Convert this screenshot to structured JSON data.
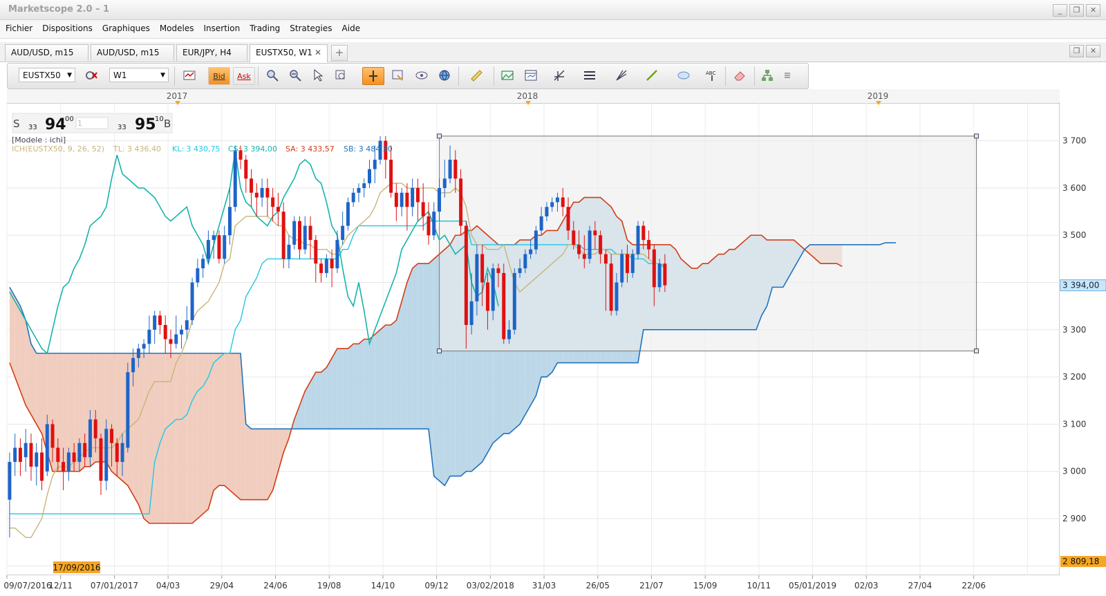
{
  "window": {
    "title": "Marketscope 2.0 – 1",
    "controls": [
      "_",
      "❐",
      "✕"
    ]
  },
  "menu": [
    "Fichier",
    "Dispositions",
    "Graphiques",
    "Modeles",
    "Insertion",
    "Trading",
    "Strategies",
    "Aide"
  ],
  "tabs": [
    {
      "label": "AUD/USD, m15",
      "active": false
    },
    {
      "label": "AUD/USD, m15",
      "active": false
    },
    {
      "label": "EUR/JPY, H4",
      "active": false
    },
    {
      "label": "EUSTX50, W1",
      "active": true
    }
  ],
  "tab_close": "✕",
  "tab_add": "+",
  "toolbar": {
    "symbol": "EUSTX50",
    "timeframe": "W1",
    "bid_label": "Bid",
    "ask_label": "Ask",
    "icons": [
      "indicator-icon",
      "candles-icon",
      "zoom-in-icon",
      "zoom-out-icon",
      "cursor-icon",
      "zoom-area-icon",
      "crosshair-icon",
      "properties-icon",
      "eye-icon",
      "globe-icon",
      "ruler-icon",
      "image-icon",
      "template-icon",
      "fibonacci-icon",
      "hlines-icon",
      "fan-icon",
      "trendline-icon",
      "ellipse-icon",
      "text-icon",
      "eraser-icon",
      "network-icon",
      "more-icon"
    ]
  },
  "chart": {
    "year_labels": [
      "2017",
      "2018",
      "2019"
    ],
    "price_ticks": [
      "3 700",
      "3 600",
      "3 500",
      "3 300",
      "3 200",
      "3 100",
      "3 000",
      "2 900"
    ],
    "current_price": "3 394,00",
    "low_marker": "2 809,18",
    "date_labels": [
      "09/07/2016",
      "12/11",
      "07/01/2017",
      "04/03",
      "29/04",
      "24/06",
      "19/08",
      "14/10",
      "09/12",
      "03/02/2018",
      "31/03",
      "26/05",
      "21/07",
      "15/09",
      "10/11",
      "05/01/2019",
      "02/03",
      "27/04",
      "22/06"
    ],
    "highlight_date": "17/09/2016",
    "sell_label": "S",
    "sell_small": "33",
    "sell_big": "94",
    "sell_sup": "00",
    "qty": "1",
    "buy_small": "33",
    "buy_big": "95",
    "buy_sup": "10",
    "buy_label": "B",
    "model": "[Modele : ichi]",
    "ich_name": "ICH(EUSTX50, 9, 26, 52)",
    "tl": "TL: 3 436,40",
    "kl": "KL: 3 430,75",
    "cs": "CS: 3 394,00",
    "sa": "SA: 3 433,57",
    "sb": "SB: 3 484,30",
    "colors": {
      "up": "#1e64c8",
      "down": "#e01010",
      "tenkan": "#c8b478",
      "kijun": "#1ec8e6",
      "chikou": "#14b4aa",
      "senkou_a": "#d23c14",
      "senkou_b": "#1e73be",
      "cloud_up": "#bcd7e8",
      "cloud_down": "#f0cdbe",
      "price_label_bg": "#c8e6fa",
      "low_label_bg": "#f5a623"
    }
  },
  "chart_data": {
    "type": "candlestick",
    "candles": [
      [
        2940,
        3020,
        2860,
        3040
      ],
      [
        3020,
        3050,
        2990,
        3080
      ],
      [
        3050,
        3020,
        2990,
        3070
      ],
      [
        3030,
        3060,
        3000,
        3090
      ],
      [
        3060,
        3010,
        2980,
        3080
      ],
      [
        3010,
        3040,
        2970,
        3060
      ],
      [
        3040,
        2980,
        2960,
        3070
      ],
      [
        3000,
        3100,
        2990,
        3120
      ],
      [
        3100,
        3050,
        3020,
        3110
      ],
      [
        3050,
        3020,
        3000,
        3070
      ],
      [
        3020,
        3000,
        2960,
        3050
      ],
      [
        3000,
        3040,
        2980,
        3050
      ],
      [
        3040,
        3020,
        3000,
        3060
      ],
      [
        3020,
        3060,
        3000,
        3070
      ],
      [
        3060,
        3030,
        3010,
        3080
      ],
      [
        3030,
        3110,
        3010,
        3130
      ],
      [
        3110,
        3070,
        3040,
        3130
      ],
      [
        3070,
        2980,
        2950,
        3080
      ],
      [
        2980,
        3090,
        2960,
        3110
      ],
      [
        3090,
        3060,
        3010,
        3100
      ],
      [
        3060,
        3020,
        2990,
        3070
      ],
      [
        3020,
        3060,
        2990,
        3080
      ],
      [
        3050,
        3210,
        3040,
        3230
      ],
      [
        3210,
        3240,
        3180,
        3260
      ],
      [
        3240,
        3260,
        3220,
        3270
      ],
      [
        3260,
        3270,
        3240,
        3280
      ],
      [
        3270,
        3300,
        3250,
        3330
      ],
      [
        3300,
        3330,
        3270,
        3340
      ],
      [
        3330,
        3310,
        3290,
        3340
      ],
      [
        3310,
        3280,
        3250,
        3330
      ],
      [
        3280,
        3270,
        3240,
        3300
      ],
      [
        3270,
        3290,
        3260,
        3330
      ],
      [
        3290,
        3300,
        3260,
        3310
      ],
      [
        3300,
        3320,
        3280,
        3350
      ],
      [
        3320,
        3400,
        3310,
        3410
      ],
      [
        3400,
        3430,
        3390,
        3450
      ],
      [
        3430,
        3450,
        3410,
        3460
      ],
      [
        3450,
        3490,
        3440,
        3510
      ],
      [
        3490,
        3500,
        3450,
        3510
      ],
      [
        3500,
        3450,
        3440,
        3510
      ],
      [
        3450,
        3500,
        3440,
        3520
      ],
      [
        3500,
        3560,
        3480,
        3600
      ],
      [
        3560,
        3680,
        3550,
        3690
      ],
      [
        3680,
        3660,
        3640,
        3690
      ],
      [
        3660,
        3620,
        3590,
        3670
      ],
      [
        3620,
        3590,
        3560,
        3640
      ],
      [
        3590,
        3580,
        3540,
        3610
      ],
      [
        3580,
        3600,
        3560,
        3620
      ],
      [
        3600,
        3580,
        3540,
        3620
      ],
      [
        3580,
        3560,
        3530,
        3600
      ],
      [
        3560,
        3550,
        3520,
        3590
      ],
      [
        3550,
        3450,
        3430,
        3570
      ],
      [
        3450,
        3480,
        3430,
        3500
      ],
      [
        3480,
        3530,
        3470,
        3540
      ],
      [
        3530,
        3470,
        3450,
        3540
      ],
      [
        3470,
        3520,
        3460,
        3540
      ],
      [
        3520,
        3490,
        3450,
        3540
      ],
      [
        3490,
        3440,
        3400,
        3500
      ],
      [
        3440,
        3420,
        3400,
        3450
      ],
      [
        3420,
        3450,
        3410,
        3460
      ],
      [
        3450,
        3430,
        3390,
        3470
      ],
      [
        3430,
        3490,
        3420,
        3510
      ],
      [
        3490,
        3520,
        3480,
        3550
      ],
      [
        3520,
        3570,
        3510,
        3580
      ],
      [
        3570,
        3590,
        3560,
        3600
      ],
      [
        3590,
        3600,
        3570,
        3610
      ],
      [
        3600,
        3610,
        3580,
        3620
      ],
      [
        3610,
        3640,
        3600,
        3660
      ],
      [
        3640,
        3660,
        3610,
        3690
      ],
      [
        3660,
        3700,
        3650,
        3710
      ],
      [
        3700,
        3660,
        3620,
        3710
      ],
      [
        3660,
        3590,
        3580,
        3690
      ],
      [
        3590,
        3560,
        3530,
        3610
      ],
      [
        3560,
        3590,
        3540,
        3600
      ],
      [
        3590,
        3560,
        3510,
        3610
      ],
      [
        3560,
        3600,
        3540,
        3620
      ],
      [
        3600,
        3570,
        3530,
        3620
      ],
      [
        3570,
        3540,
        3510,
        3610
      ],
      [
        3540,
        3500,
        3480,
        3570
      ],
      [
        3500,
        3550,
        3490,
        3570
      ],
      [
        3550,
        3600,
        3530,
        3620
      ],
      [
        3600,
        3620,
        3580,
        3660
      ],
      [
        3620,
        3660,
        3610,
        3690
      ],
      [
        3660,
        3620,
        3590,
        3680
      ],
      [
        3620,
        3520,
        3500,
        3640
      ],
      [
        3520,
        3310,
        3260,
        3530
      ],
      [
        3310,
        3360,
        3290,
        3420
      ],
      [
        3360,
        3460,
        3330,
        3480
      ],
      [
        3460,
        3400,
        3350,
        3480
      ],
      [
        3400,
        3340,
        3300,
        3420
      ],
      [
        3340,
        3430,
        3320,
        3440
      ],
      [
        3430,
        3420,
        3390,
        3440
      ],
      [
        3420,
        3280,
        3270,
        3440
      ],
      [
        3280,
        3300,
        3270,
        3320
      ],
      [
        3300,
        3420,
        3290,
        3430
      ],
      [
        3420,
        3430,
        3410,
        3450
      ],
      [
        3430,
        3460,
        3420,
        3470
      ],
      [
        3460,
        3470,
        3450,
        3490
      ],
      [
        3470,
        3510,
        3460,
        3520
      ],
      [
        3510,
        3540,
        3500,
        3560
      ],
      [
        3540,
        3560,
        3530,
        3570
      ],
      [
        3560,
        3570,
        3550,
        3580
      ],
      [
        3570,
        3580,
        3550,
        3590
      ],
      [
        3580,
        3560,
        3540,
        3600
      ],
      [
        3560,
        3510,
        3490,
        3580
      ],
      [
        3510,
        3480,
        3470,
        3530
      ],
      [
        3480,
        3460,
        3450,
        3510
      ],
      [
        3460,
        3450,
        3430,
        3500
      ],
      [
        3450,
        3510,
        3440,
        3520
      ],
      [
        3510,
        3500,
        3470,
        3530
      ],
      [
        3500,
        3460,
        3440,
        3510
      ],
      [
        3460,
        3440,
        3340,
        3470
      ],
      [
        3440,
        3340,
        3330,
        3460
      ],
      [
        3340,
        3400,
        3330,
        3420
      ],
      [
        3400,
        3460,
        3390,
        3470
      ],
      [
        3460,
        3420,
        3400,
        3480
      ],
      [
        3420,
        3460,
        3410,
        3470
      ],
      [
        3460,
        3520,
        3450,
        3530
      ],
      [
        3520,
        3490,
        3470,
        3530
      ],
      [
        3490,
        3470,
        3450,
        3510
      ],
      [
        3470,
        3390,
        3350,
        3480
      ],
      [
        3390,
        3440,
        3380,
        3450
      ],
      [
        3440,
        3394,
        3380,
        3460
      ]
    ],
    "tenkan": [
      2880,
      2880,
      2870,
      2860,
      2860,
      2880,
      2900,
      2950,
      2990,
      3010,
      3010,
      3010,
      3020,
      3030,
      3040,
      3050,
      3050,
      3050,
      3050,
      3050,
      3060,
      3080,
      3090,
      3100,
      3110,
      3140,
      3170,
      3190,
      3190,
      3190,
      3190,
      3230,
      3250,
      3280,
      3320,
      3340,
      3350,
      3360,
      3380,
      3400,
      3440,
      3450,
      3520,
      3530,
      3540,
      3540,
      3540,
      3540,
      3540,
      3530,
      3520,
      3520,
      3500,
      3490,
      3490,
      3480,
      3480,
      3470,
      3470,
      3470,
      3460,
      3460,
      3480,
      3500,
      3510,
      3520,
      3530,
      3540,
      3560,
      3590,
      3600,
      3610,
      3610,
      3610,
      3600,
      3600,
      3600,
      3600,
      3600,
      3600,
      3590,
      3590,
      3590,
      3600,
      3590,
      3560,
      3500,
      3480,
      3480,
      3470,
      3470,
      3470,
      3480,
      3440,
      3400,
      3380,
      3390,
      3400,
      3410,
      3420,
      3430,
      3440,
      3450,
      3460,
      3480,
      3480,
      3470,
      3460,
      3460,
      3460,
      3470,
      3470,
      3460,
      3460,
      3460,
      3460,
      3460,
      3460,
      3460,
      3450,
      3440,
      3440,
      3436
    ],
    "kijun": [
      2910,
      2910,
      2910,
      2910,
      2910,
      2910,
      2910,
      2910,
      2910,
      2910,
      2910,
      2910,
      2910,
      2910,
      2910,
      2910,
      2910,
      2910,
      2910,
      2910,
      2910,
      2910,
      2910,
      2910,
      2910,
      2910,
      2910,
      3020,
      3060,
      3090,
      3100,
      3110,
      3110,
      3120,
      3150,
      3170,
      3180,
      3200,
      3230,
      3240,
      3250,
      3250,
      3300,
      3320,
      3370,
      3390,
      3410,
      3440,
      3450,
      3450,
      3450,
      3450,
      3450,
      3450,
      3450,
      3450,
      3450,
      3450,
      3450,
      3450,
      3450,
      3450,
      3470,
      3470,
      3500,
      3520,
      3520,
      3520,
      3520,
      3520,
      3520,
      3520,
      3520,
      3520,
      3520,
      3520,
      3520,
      3520,
      3530,
      3530,
      3530,
      3530,
      3530,
      3530,
      3530,
      3530,
      3480,
      3480,
      3480,
      3480,
      3480,
      3480,
      3480,
      3480,
      3480,
      3480,
      3480,
      3480,
      3480,
      3480,
      3480,
      3480,
      3480,
      3480,
      3480,
      3480,
      3480,
      3470,
      3470,
      3470,
      3470,
      3470,
      3470,
      3460,
      3460,
      3460,
      3450,
      3450,
      3450,
      3440,
      3440,
      3440,
      3430
    ],
    "chikou_start": 0,
    "chikou": [
      3380,
      3360,
      3340,
      3320,
      3300,
      3280,
      3260,
      3250,
      3300,
      3350,
      3390,
      3400,
      3430,
      3450,
      3480,
      3520,
      3530,
      3540,
      3560,
      3620,
      3670,
      3630,
      3620,
      3610,
      3600,
      3600,
      3590,
      3580,
      3560,
      3540,
      3530,
      3540,
      3550,
      3560,
      3520,
      3500,
      3480,
      3440,
      3480,
      3520,
      3560,
      3600,
      3680,
      3600,
      3570,
      3560,
      3540,
      3530,
      3520,
      3540,
      3550,
      3580,
      3600,
      3620,
      3650,
      3660,
      3650,
      3620,
      3610,
      3570,
      3520,
      3500,
      3430,
      3370,
      3350,
      3400,
      3340,
      3270,
      3300,
      3330,
      3360,
      3390,
      3420,
      3470,
      3490,
      3510,
      3530,
      3540,
      3550,
      3520,
      3490,
      3500,
      3480,
      3460,
      3470,
      3480,
      3400,
      3370,
      3380,
      3430,
      3400,
      3350
    ],
    "senkou_a": [
      3230,
      3200,
      3170,
      3140,
      3120,
      3100,
      3080,
      3040,
      3000,
      3000,
      3000,
      3000,
      3000,
      3000,
      3010,
      3010,
      3020,
      3020,
      3020,
      3000,
      2990,
      2980,
      2970,
      2950,
      2930,
      2900,
      2890,
      2890,
      2890,
      2890,
      2890,
      2890,
      2890,
      2890,
      2890,
      2900,
      2910,
      2920,
      2960,
      2970,
      2970,
      2960,
      2950,
      2940,
      2940,
      2940,
      2940,
      2940,
      2940,
      2960,
      3000,
      3040,
      3070,
      3110,
      3140,
      3170,
      3190,
      3210,
      3210,
      3220,
      3240,
      3260,
      3260,
      3260,
      3270,
      3270,
      3280,
      3280,
      3290,
      3300,
      3310,
      3310,
      3320,
      3360,
      3400,
      3430,
      3440,
      3440,
      3440,
      3450,
      3460,
      3470,
      3480,
      3500,
      3500,
      3510,
      3510,
      3520,
      3510,
      3500,
      3490,
      3480,
      3480,
      3480,
      3480,
      3490,
      3490,
      3490,
      3500,
      3500,
      3510,
      3510,
      3510,
      3530,
      3550,
      3570,
      3570,
      3580,
      3580,
      3580,
      3580,
      3570,
      3560,
      3540,
      3530,
      3490,
      3480,
      3480,
      3480,
      3480,
      3480,
      3480,
      3480,
      3480,
      3470,
      3450,
      3440,
      3430,
      3430,
      3440,
      3440,
      3450,
      3460,
      3460,
      3470,
      3470,
      3480,
      3490,
      3500,
      3500,
      3500,
      3490,
      3490,
      3490,
      3490,
      3490,
      3490,
      3480,
      3470,
      3460,
      3450,
      3440,
      3440,
      3440,
      3440,
      3434
    ],
    "senkou_b": [
      3390,
      3370,
      3350,
      3320,
      3270,
      3250,
      3250,
      3250,
      3250,
      3250,
      3250,
      3250,
      3250,
      3250,
      3250,
      3250,
      3250,
      3250,
      3250,
      3250,
      3250,
      3250,
      3250,
      3250,
      3250,
      3250,
      3250,
      3250,
      3250,
      3250,
      3250,
      3250,
      3250,
      3250,
      3250,
      3250,
      3250,
      3250,
      3250,
      3250,
      3250,
      3250,
      3250,
      3250,
      3100,
      3090,
      3090,
      3090,
      3090,
      3090,
      3090,
      3090,
      3090,
      3090,
      3090,
      3090,
      3090,
      3090,
      3090,
      3090,
      3090,
      3090,
      3090,
      3090,
      3090,
      3090,
      3090,
      3090,
      3090,
      3090,
      3090,
      3090,
      3090,
      3090,
      3090,
      3090,
      3090,
      3090,
      3090,
      2990,
      2980,
      2970,
      2990,
      2990,
      2990,
      3000,
      3000,
      3010,
      3020,
      3040,
      3060,
      3070,
      3080,
      3080,
      3090,
      3100,
      3120,
      3140,
      3160,
      3200,
      3200,
      3210,
      3230,
      3230,
      3230,
      3230,
      3230,
      3230,
      3230,
      3230,
      3230,
      3230,
      3230,
      3230,
      3230,
      3230,
      3230,
      3230,
      3300,
      3300,
      3300,
      3300,
      3300,
      3300,
      3300,
      3300,
      3300,
      3300,
      3300,
      3300,
      3300,
      3300,
      3300,
      3300,
      3300,
      3300,
      3300,
      3300,
      3300,
      3300,
      3330,
      3350,
      3390,
      3390,
      3390,
      3410,
      3430,
      3450,
      3470,
      3480,
      3480,
      3480,
      3480,
      3480,
      3480,
      3480,
      3480,
      3480,
      3480,
      3480,
      3480,
      3480,
      3480,
      3484,
      3484,
      3484
    ],
    "box": {
      "from_index": 80,
      "to_index": 180,
      "price_top": 3710,
      "price_bottom": 3255
    },
    "y_range": [
      2780,
      3780
    ],
    "weeks_total": 196
  }
}
